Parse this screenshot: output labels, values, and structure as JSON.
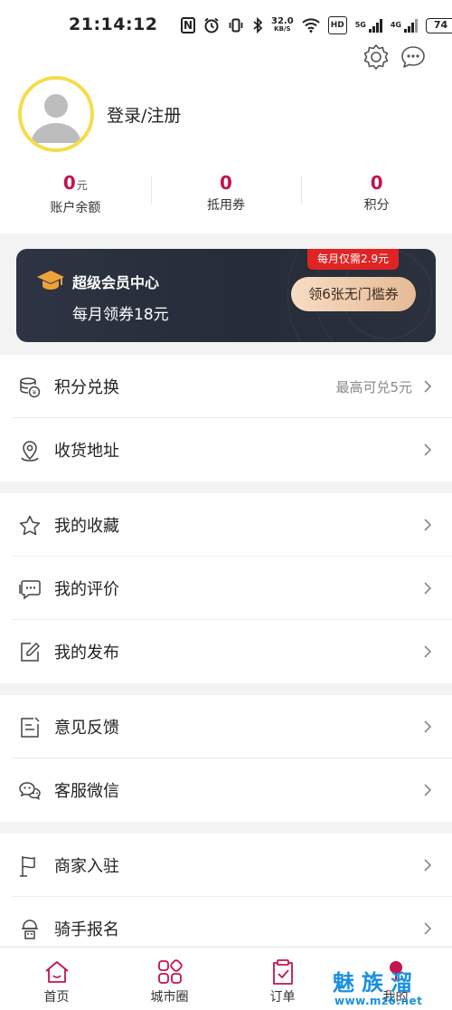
{
  "status_bar": {
    "time": "21:14:12",
    "nfc": "N",
    "net_speed_value": "32.0",
    "net_speed_unit": "KB/S",
    "hd": "HD",
    "net_5g": "5G",
    "net_4g": "4G",
    "battery": "74"
  },
  "header": {
    "settings_icon": "gear-icon",
    "message_icon": "chat-bubble-icon"
  },
  "profile": {
    "avatar_icon": "default-user-avatar",
    "login_label": "登录/注册"
  },
  "stats": [
    {
      "value": "0",
      "unit": "元",
      "label": "账户余额"
    },
    {
      "value": "0",
      "unit": "",
      "label": "抵用券"
    },
    {
      "value": "0",
      "unit": "",
      "label": "积分"
    }
  ],
  "vip": {
    "icon": "graduation-cap-icon",
    "title": "超级会员中心",
    "subtitle": "每月领券18元",
    "badge": "每月仅需2.9元",
    "button": "领6张无门槛券"
  },
  "menu_groups": [
    [
      {
        "icon": "coins-exchange-icon",
        "label": "积分兑换",
        "extra": "最高可兑5元"
      },
      {
        "icon": "location-pin-icon",
        "label": "收货地址",
        "extra": ""
      }
    ],
    [
      {
        "icon": "star-icon",
        "label": "我的收藏",
        "extra": ""
      },
      {
        "icon": "comment-icon",
        "label": "我的评价",
        "extra": ""
      },
      {
        "icon": "edit-icon",
        "label": "我的发布",
        "extra": ""
      }
    ],
    [
      {
        "icon": "feedback-icon",
        "label": "意见反馈",
        "extra": ""
      },
      {
        "icon": "wechat-icon",
        "label": "客服微信",
        "extra": ""
      }
    ],
    [
      {
        "icon": "flag-icon",
        "label": "商家入驻",
        "extra": ""
      },
      {
        "icon": "rider-icon",
        "label": "骑手报名",
        "extra": ""
      }
    ]
  ],
  "tabbar": [
    {
      "icon": "home-icon",
      "label": "首页"
    },
    {
      "icon": "grid-icon",
      "label": "城市圈"
    },
    {
      "icon": "order-clipboard-icon",
      "label": "订单"
    },
    {
      "icon": "user-icon",
      "label": "我的"
    }
  ],
  "watermark": {
    "text": "魅族溜",
    "url": "www.mz6.net"
  },
  "colors": {
    "accent": "#c4134d",
    "vip_bg": "#2a303c",
    "vip_badge": "#e02424",
    "avatar_ring": "#f3dd4a"
  }
}
